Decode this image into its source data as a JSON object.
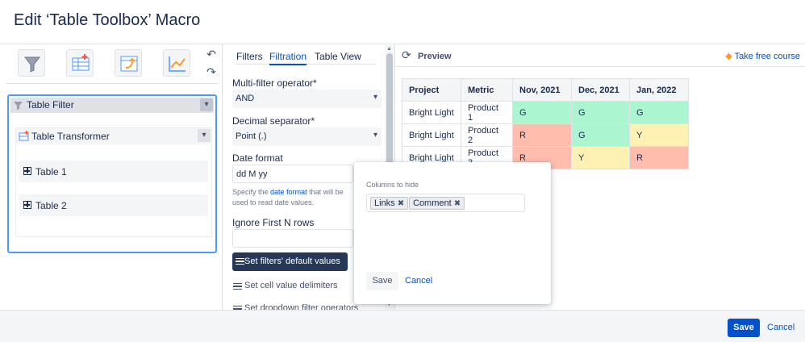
{
  "dialog": {
    "title": "Edit ‘Table Toolbox’ Macro"
  },
  "toolbar": {
    "icons": [
      "table-filter-icon",
      "table-transformer-icon",
      "table-spreadsheet-icon",
      "table-chart-icon"
    ],
    "undo_icon": "undo-icon",
    "redo_icon": "redo-icon"
  },
  "tree": {
    "filter_label": "Table Filter",
    "transformer_label": "Table Transformer",
    "tables": [
      "Table 1",
      "Table 2"
    ]
  },
  "settings": {
    "tabs": [
      "Filters",
      "Filtration",
      "Table View"
    ],
    "active_tab": "Filtration",
    "multi_filter_label": "Multi-filter operator*",
    "multi_filter_value": "AND",
    "decimal_label": "Decimal separator*",
    "decimal_value": "Point (.)",
    "date_format_label": "Date format",
    "date_format_value": "dd M yy",
    "hint_prefix": "Specify the",
    "hint_link": "date format",
    "hint_suffix": "that will be used to read date values.",
    "ignore_rows_label": "Ignore First N rows",
    "ignore_rows_value": "",
    "default_values_button": "Set filters' default values",
    "delimiters_link": "Set cell value delimiters",
    "dropdown_ops_link": "Set dropdown filter operators"
  },
  "preview": {
    "title": "Preview",
    "course_link": "Take free course",
    "columns": [
      "Project",
      "Metric",
      "Nov, 2021",
      "Dec, 2021",
      "Jan, 2022"
    ],
    "rows": [
      [
        "Bright Light",
        "Product 1",
        "G",
        "G",
        "G"
      ],
      [
        "Bright Light",
        "Product 2",
        "R",
        "G",
        "Y"
      ],
      [
        "Bright Light",
        "Product 3",
        "R",
        "Y",
        "R"
      ]
    ],
    "status_colors": {
      "G": "#abf5d1",
      "R": "#ffbdad",
      "Y": "#fff0b3"
    }
  },
  "popup": {
    "label": "Columns to hide",
    "tags": [
      "Links",
      "Comment"
    ],
    "save": "Save",
    "cancel": "Cancel"
  },
  "footer": {
    "save": "Save",
    "cancel": "Cancel"
  },
  "colors": {
    "primary": "#0052cc",
    "focus": "#4c9aff",
    "dark_button": "#253858"
  }
}
